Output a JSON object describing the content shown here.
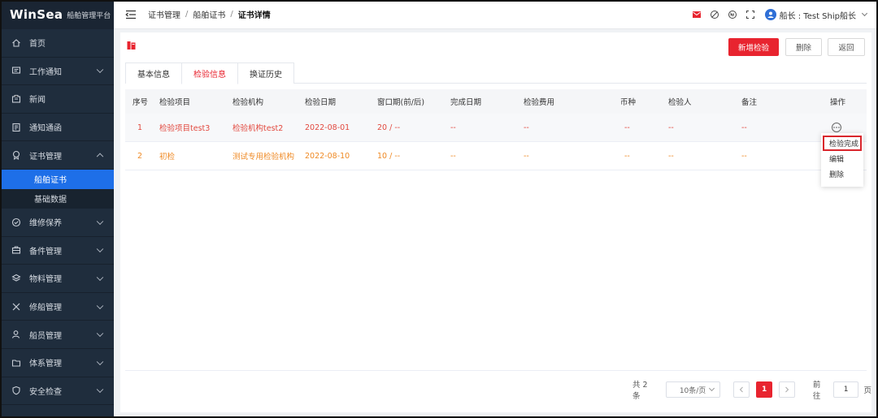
{
  "sidebar": {
    "brand": "WinSea",
    "brand_sub": "船舶管理平台",
    "items": [
      {
        "label": "首页"
      },
      {
        "label": "工作通知"
      },
      {
        "label": "新闻"
      },
      {
        "label": "通知通函"
      },
      {
        "label": "证书管理"
      },
      {
        "label": "维修保养"
      },
      {
        "label": "备件管理"
      },
      {
        "label": "物料管理"
      },
      {
        "label": "修船管理"
      },
      {
        "label": "船员管理"
      },
      {
        "label": "体系管理"
      },
      {
        "label": "安全检查"
      }
    ],
    "sub_items": [
      {
        "label": "船舶证书"
      },
      {
        "label": "基础数据"
      }
    ]
  },
  "header": {
    "breadcrumb": [
      "证书管理",
      "船舶证书",
      "证书详情"
    ],
    "user": "船长 : Test Ship船长"
  },
  "toolbar": {
    "add_label": "新增检验",
    "delete_label": "删除",
    "back_label": "返回"
  },
  "tabs": [
    {
      "label": "基本信息"
    },
    {
      "label": "检验信息"
    },
    {
      "label": "换证历史"
    }
  ],
  "table": {
    "columns": [
      "序号",
      "检验项目",
      "检验机构",
      "检验日期",
      "窗口期(前/后)",
      "完成日期",
      "检验费用",
      "币种",
      "检验人",
      "备注",
      "操作"
    ],
    "rows": [
      {
        "no": "1",
        "item": "检验项目test3",
        "org": "检验机构test2",
        "date": "2022-08-01",
        "window": "20 / --",
        "done": "--",
        "fee": "--",
        "currency": "--",
        "inspector": "--",
        "remark": "--"
      },
      {
        "no": "2",
        "item": "初检",
        "org": "测试专用检验机构",
        "date": "2022-08-10",
        "window": "10 / --",
        "done": "--",
        "fee": "--",
        "currency": "--",
        "inspector": "--",
        "remark": "--"
      }
    ]
  },
  "dropdown": {
    "items": [
      {
        "label": "检验完成"
      },
      {
        "label": "编辑"
      },
      {
        "label": "删除"
      }
    ]
  },
  "pagination": {
    "total": "共 2 条",
    "page_size": "10条/页",
    "current": "1",
    "goto_label": "前往",
    "goto_value": "1",
    "page_unit": "页"
  },
  "colors": {
    "accent": "#e8242f",
    "sidebar_bg": "#1f2d3d",
    "sidebar_active": "#1e6fe8",
    "row1_text": "#e2493f",
    "row2_text": "#ef8a25"
  }
}
